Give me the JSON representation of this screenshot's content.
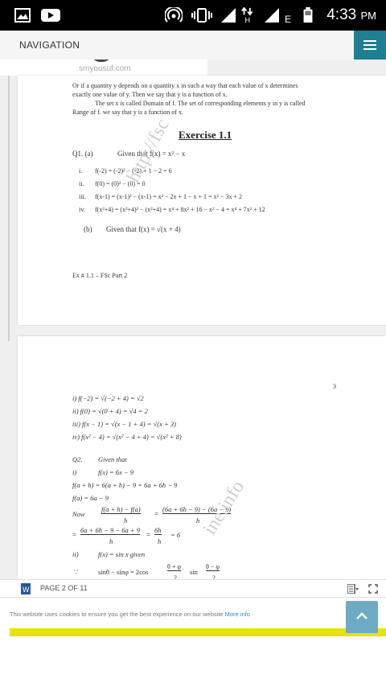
{
  "status_bar": {
    "time": "4:33",
    "ampm": "PM",
    "network_label": "E"
  },
  "app_bar": {
    "title": "NAVIGATION"
  },
  "viewer": {
    "site_url": "smyousuf.com",
    "page1": {
      "intro_line1": "Or  if a quantity y depends on a quantity x in such a way that each value of x determines",
      "intro_line2": "exactly one value of y. Then we say that y is a function of x.",
      "intro_line3": "The set x is called Domain of f. The set of corresponding elements y in y is called",
      "intro_line4": "Range of f. we say that y is a function of x.",
      "exercise_title": "Exercise 1.1",
      "q1a_label": "Q1. (a)",
      "q1a_given": "Given that f(x) = x² − x",
      "items": [
        {
          "num": "i.",
          "text": "f(-2) = (-2)² − (-2) + 1 − 2 = 6"
        },
        {
          "num": "ii.",
          "text": "f(0) = (0)² − (0) = 0"
        },
        {
          "num": "iii.",
          "text": "f(x-1) = (x-1)² − (x-1) = x² − 2x + 1 − x + 1 = x² − 3x + 2"
        },
        {
          "num": "iv.",
          "text": "f(x²+4) = (x²+4)² − (x²+4) = x⁴ + 8x² + 16 − x² − 4 = x⁴ + 7x² + 12"
        }
      ],
      "q1b_label": "(b)",
      "q1b_given": "Given that  f(x) = √(x + 4)",
      "footer": "Ex # 1.1 – FSc Part 2",
      "watermark": "http://fsc"
    },
    "page2": {
      "page_number": "3",
      "lines": [
        "i) f(−2) = √(−2 + 4) = √2",
        "ii) f(0) = √(0 + 4) = √4 = 2",
        "iii) f(x − 1) = √(x − 1 + 4) = √(x + 3)",
        "iv) f(x² − 4) = √(x² − 4 + 4) = √(x² + 8)"
      ],
      "q2_label": "Q2.",
      "q2_given": "Given that",
      "q2_i": "i)",
      "q2_fx": "f(x) = 6x − 9",
      "q2_l1": "f(a + h) = 6(a + h) − 9 = 6a + 6h − 9",
      "q2_l2": "f(a) = 6a − 9",
      "now_label": "Now",
      "frac1_num": "f(a + h) − f(a)",
      "frac1_den": "h",
      "frac2_num": "(6a + 6h − 9) − (6a − 9)",
      "frac2_den": "h",
      "frac3_num": "6a + 6h − 9 − 6a + 9",
      "frac3_den": "h",
      "frac4_num": "6h",
      "frac4_den": "h",
      "result": "= 6",
      "ii_label": "ii)",
      "ii_text": "f(x) = sin x    given",
      "because": "∵",
      "sin_line_a": "sinθ − sinφ = 2cos",
      "half_num": "θ + φ",
      "half_den": "2",
      "sin_word": "sin",
      "half2_num": "θ − φ",
      "half2_den": "2",
      "watermark": "ine.info"
    }
  },
  "bottom_bar": {
    "page_indicator": "PAGE 2 OF 11"
  },
  "cookie_banner": {
    "text": "This website uses cookies to ensure you get the best experience on our website ",
    "link": "More info"
  },
  "colors": {
    "accent": "#1e7f93",
    "scroll_top": "#6cabc3",
    "banner": "#e8e210"
  }
}
